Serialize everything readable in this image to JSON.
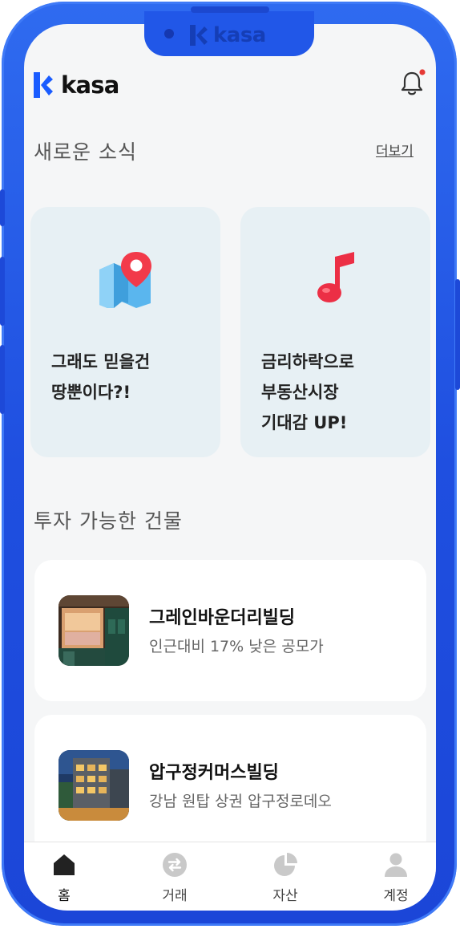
{
  "device": {
    "notch_logo": "kasa"
  },
  "header": {
    "logo_text": "kasa",
    "notification_dot_color": "#e53935"
  },
  "news": {
    "title": "새로운 소식",
    "more_label": "더보기",
    "cards": [
      {
        "icon": "map-pin-icon",
        "lines": [
          "그래도 믿을건",
          "땅뿐이다?!"
        ]
      },
      {
        "icon": "music-note-icon",
        "lines": [
          "금리하락으로",
          "부동산시장",
          "기대감 UP!"
        ]
      }
    ]
  },
  "buildings": {
    "title": "투자 가능한 건물",
    "items": [
      {
        "name": "그레인바운더리빌딩",
        "description": "인근대비 17% 낮은 공모가"
      },
      {
        "name": "압구정커머스빌딩",
        "description": "강남 원탑 상권 압구정로데오"
      }
    ]
  },
  "tabbar": {
    "tabs": [
      {
        "label": "홈",
        "icon": "home-icon",
        "active": true
      },
      {
        "label": "거래",
        "icon": "exchange-icon",
        "active": false
      },
      {
        "label": "자산",
        "icon": "pie-chart-icon",
        "active": false
      },
      {
        "label": "계정",
        "icon": "user-icon",
        "active": false
      }
    ]
  },
  "colors": {
    "frame_blue": "#2157e8",
    "brand_blue": "#1a5cff",
    "card_bg": "#e7f0f4"
  }
}
